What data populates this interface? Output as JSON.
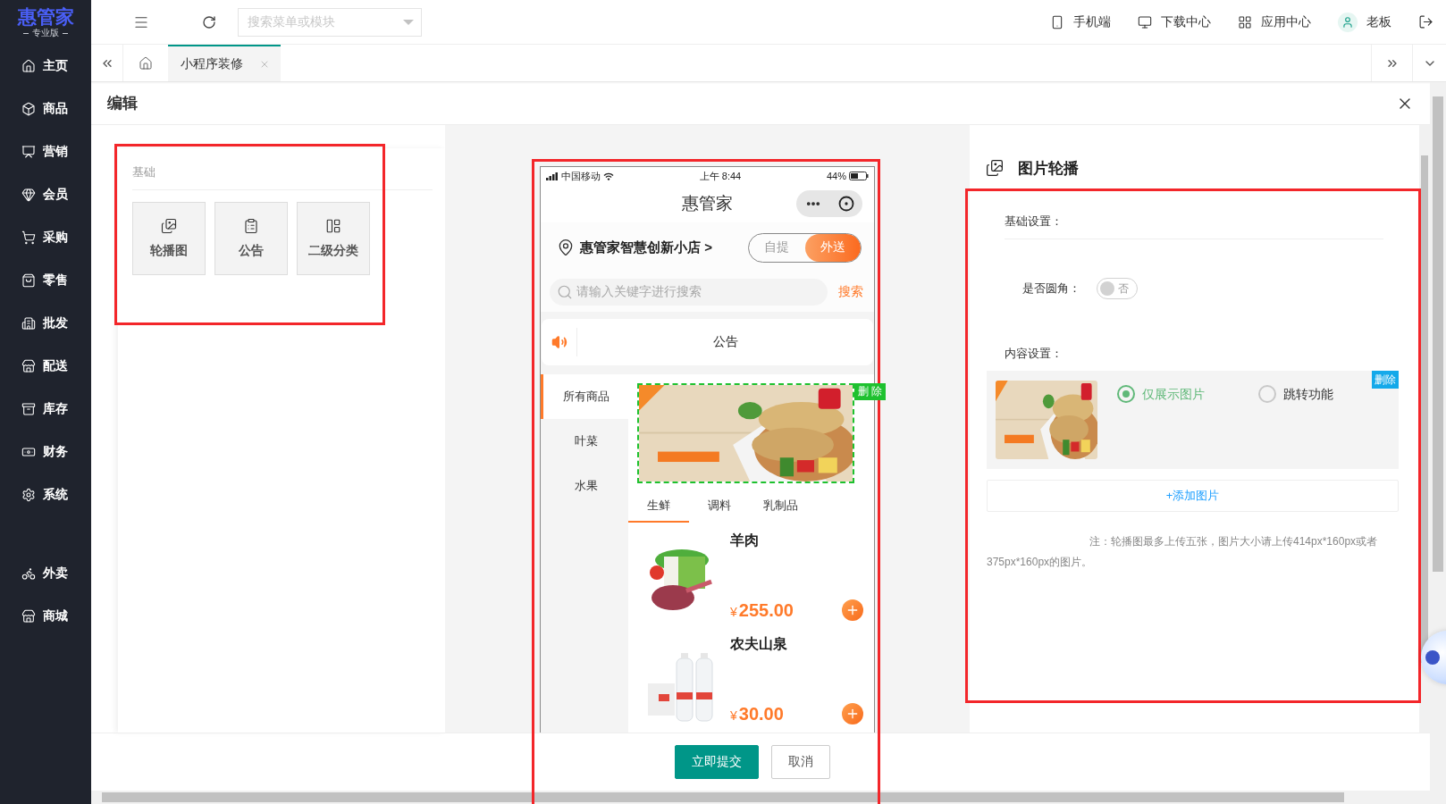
{
  "logo": {
    "name": "惠管家",
    "edition": "专业版"
  },
  "sidebar": {
    "groups": [
      [
        {
          "label": "主页"
        },
        {
          "label": "商品"
        },
        {
          "label": "营销"
        },
        {
          "label": "会员"
        },
        {
          "label": "采购"
        },
        {
          "label": "零售"
        },
        {
          "label": "批发"
        },
        {
          "label": "配送"
        },
        {
          "label": "库存"
        },
        {
          "label": "财务"
        },
        {
          "label": "系统"
        }
      ],
      [
        {
          "label": "外卖"
        },
        {
          "label": "商城"
        }
      ]
    ]
  },
  "topbar": {
    "search": {
      "placeholder": "搜索菜单或模块"
    },
    "links": [
      {
        "label": "手机端",
        "kind": "link"
      },
      {
        "label": "下载中心",
        "kind": "link"
      },
      {
        "label": "应用中心",
        "kind": "link"
      },
      {
        "label": "老板",
        "kind": "user"
      }
    ]
  },
  "tabs": [
    {
      "label": "小程序装修",
      "selected": true
    }
  ],
  "editor": {
    "title": "编辑"
  },
  "palette": {
    "section": "基础",
    "components": [
      {
        "label": "轮播图"
      },
      {
        "label": "公告"
      },
      {
        "label": "二级分类"
      }
    ]
  },
  "phone": {
    "status": {
      "carrier": "中国移动",
      "time": "上午 8:44",
      "battery": "44%"
    },
    "title": "惠管家",
    "store": "惠管家智慧创新小店 >",
    "modes": [
      {
        "label": "自提",
        "selected": false
      },
      {
        "label": "外送",
        "selected": true
      }
    ],
    "search": {
      "placeholder": "请输入关键字进行搜索",
      "button": "搜索"
    },
    "notice": "公告",
    "categories": [
      {
        "label": "所有商品",
        "selected": true
      },
      {
        "label": "叶菜",
        "selected": false
      },
      {
        "label": "水果",
        "selected": false
      }
    ],
    "banner_delete": "删 除",
    "subtabs": [
      {
        "label": "生鲜",
        "selected": true
      },
      {
        "label": "调料",
        "selected": false
      },
      {
        "label": "乳制品",
        "selected": false
      }
    ],
    "products": [
      {
        "name": "羊肉",
        "currency": "¥",
        "price": "255.00",
        "kind": "meat"
      },
      {
        "name": "农夫山泉",
        "currency": "¥",
        "price": "30.00",
        "kind": "water"
      }
    ]
  },
  "settings": {
    "title": "图片轮播",
    "basic_label": "基础设置：",
    "rounded": {
      "label": "是否圆角：",
      "on": false,
      "text": "否"
    },
    "content_label": "内容设置：",
    "images": [
      {
        "options": [
          {
            "label": "仅展示图片",
            "selected": true
          },
          {
            "label": "跳转功能",
            "selected": false
          }
        ],
        "delete": "删除"
      }
    ],
    "add": "+添加图片",
    "note": "注：轮播图最多上传五张，图片大小请上传414px*160px或者375px*160px的图片。"
  },
  "actions": [
    {
      "label": "立即提交",
      "kind": "primary"
    },
    {
      "label": "取消",
      "kind": "secondary"
    }
  ]
}
